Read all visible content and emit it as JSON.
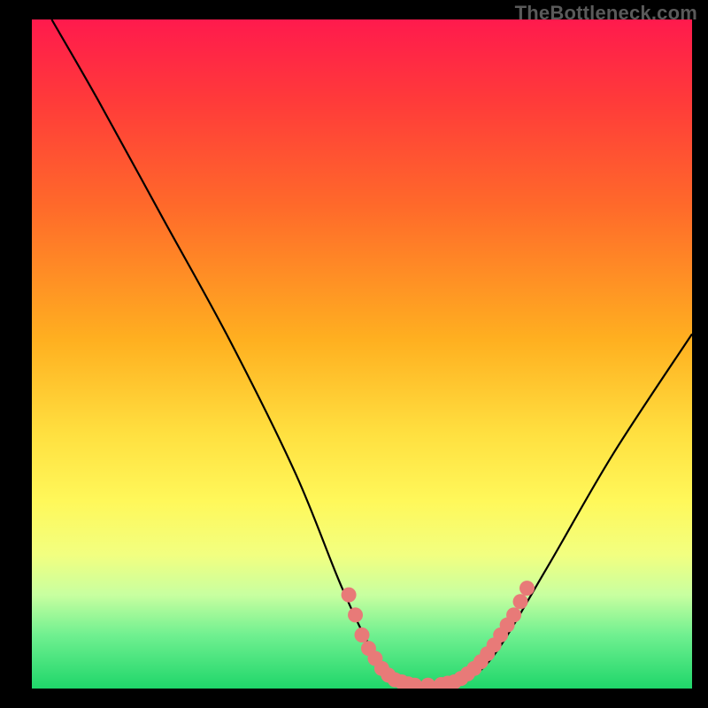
{
  "watermark": "TheBottleneck.com",
  "chart_data": {
    "type": "line",
    "title": "",
    "xlabel": "",
    "ylabel": "",
    "xlim": [
      0,
      100
    ],
    "ylim": [
      0,
      100
    ],
    "series": [
      {
        "name": "curve",
        "points": [
          {
            "x": 3,
            "y": 100
          },
          {
            "x": 10,
            "y": 88
          },
          {
            "x": 20,
            "y": 70
          },
          {
            "x": 30,
            "y": 52
          },
          {
            "x": 40,
            "y": 32
          },
          {
            "x": 47,
            "y": 15
          },
          {
            "x": 52,
            "y": 5
          },
          {
            "x": 56,
            "y": 1
          },
          {
            "x": 60,
            "y": 0.5
          },
          {
            "x": 65,
            "y": 1
          },
          {
            "x": 70,
            "y": 5
          },
          {
            "x": 78,
            "y": 18
          },
          {
            "x": 88,
            "y": 35
          },
          {
            "x": 100,
            "y": 53
          }
        ]
      }
    ],
    "markers": {
      "name": "highlight-dots",
      "color": "#e87a78",
      "points": [
        {
          "x": 48,
          "y": 14
        },
        {
          "x": 49,
          "y": 11
        },
        {
          "x": 50,
          "y": 8
        },
        {
          "x": 51,
          "y": 6
        },
        {
          "x": 52,
          "y": 4.5
        },
        {
          "x": 53,
          "y": 3
        },
        {
          "x": 54,
          "y": 2
        },
        {
          "x": 55,
          "y": 1.3
        },
        {
          "x": 56,
          "y": 1
        },
        {
          "x": 57,
          "y": 0.7
        },
        {
          "x": 58,
          "y": 0.5
        },
        {
          "x": 60,
          "y": 0.5
        },
        {
          "x": 62,
          "y": 0.6
        },
        {
          "x": 63,
          "y": 0.8
        },
        {
          "x": 64,
          "y": 1
        },
        {
          "x": 65,
          "y": 1.5
        },
        {
          "x": 66,
          "y": 2.2
        },
        {
          "x": 67,
          "y": 3
        },
        {
          "x": 68,
          "y": 4
        },
        {
          "x": 69,
          "y": 5.2
        },
        {
          "x": 70,
          "y": 6.5
        },
        {
          "x": 71,
          "y": 8
        },
        {
          "x": 72,
          "y": 9.5
        },
        {
          "x": 73,
          "y": 11
        },
        {
          "x": 74,
          "y": 13
        },
        {
          "x": 75,
          "y": 15
        }
      ]
    }
  }
}
